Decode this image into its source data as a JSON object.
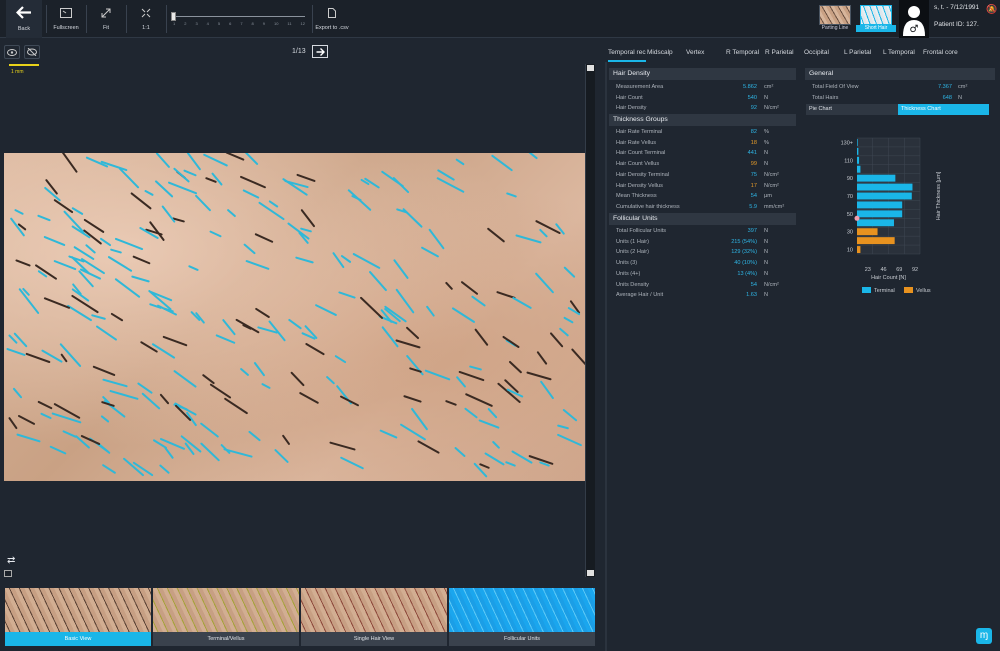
{
  "toolbar": {
    "back": "Back",
    "fullscreen": "Fullscreen",
    "fit": "Fit",
    "one_to_one": "1:1",
    "export": "Export to .csv",
    "slider_ticks": [
      "1",
      "2",
      "3",
      "4",
      "5",
      "6",
      "7",
      "8",
      "9",
      "10",
      "11",
      "12"
    ],
    "zoom_value": 0.0
  },
  "views": {
    "parting_line": "Parting Line",
    "short_hair": "Short Hair"
  },
  "patient": {
    "name_date": "s, t. - 7/12/1991",
    "id_label": "Patient ID:",
    "id_value": "127."
  },
  "image_nav": {
    "counter": "1/13",
    "scale": "1 mm"
  },
  "bottom_views": [
    {
      "label": "Basic View",
      "active": true
    },
    {
      "label": "Terminal/Vellus",
      "active": false
    },
    {
      "label": "Single Hair View",
      "active": false
    },
    {
      "label": "Follicular Units",
      "active": false
    }
  ],
  "tabs": [
    "Temporal rec",
    "Midscalp",
    "Vertex",
    "R Temporal",
    "R Parietal",
    "Occipital",
    "L Parietal",
    "L Temporal",
    "Frontal core"
  ],
  "hair_density": {
    "title": "Hair Density",
    "rows": [
      {
        "label": "Measurement Area",
        "value": "5.862",
        "unit": "cm²"
      },
      {
        "label": "Hair Count",
        "value": "540",
        "unit": "N"
      },
      {
        "label": "Hair Density",
        "value": "92",
        "unit": "N/cm²"
      }
    ]
  },
  "thickness_groups": {
    "title": "Thickness Groups",
    "rows": [
      {
        "label": "Hair Rate Terminal",
        "value": "82",
        "unit": "%",
        "orange": false
      },
      {
        "label": "Hair Rate Vellus",
        "value": "18",
        "unit": "%",
        "orange": true
      },
      {
        "label": "Hair Count Terminal",
        "value": "441",
        "unit": "N",
        "orange": false
      },
      {
        "label": "Hair Count Vellus",
        "value": "99",
        "unit": "N",
        "orange": true
      },
      {
        "label": "Hair Density Terminal",
        "value": "75",
        "unit": "N/cm²",
        "orange": false
      },
      {
        "label": "Hair Density Vellus",
        "value": "17",
        "unit": "N/cm²",
        "orange": true
      },
      {
        "label": "Mean Thickness",
        "value": "54",
        "unit": "µm",
        "orange": false
      },
      {
        "label": "Cumulative hair thickness",
        "value": "5.9",
        "unit": "mm/cm²",
        "orange": false
      }
    ]
  },
  "follicular_units": {
    "title": "Follicular Units",
    "rows": [
      {
        "label": "Total Follicular Units",
        "value": "397",
        "unit": "N"
      },
      {
        "label": "Units (1 Hair)",
        "value": "215 (54%)",
        "unit": "N"
      },
      {
        "label": "Units (2 Hair)",
        "value": "129 (32%)",
        "unit": "N"
      },
      {
        "label": "Units (3)",
        "value": "40 (10%)",
        "unit": "N"
      },
      {
        "label": "Units (4+)",
        "value": "13 (4%)",
        "unit": "N"
      },
      {
        "label": "Units Density",
        "value": "54",
        "unit": "N/cm²"
      },
      {
        "label": "Average Hair / Unit",
        "value": "1.63",
        "unit": "N"
      }
    ]
  },
  "general": {
    "title": "General",
    "rows": [
      {
        "label": "Total Field Of View",
        "value": "7.367",
        "unit": "cm²"
      },
      {
        "label": "Total Hairs",
        "value": "648",
        "unit": "N"
      }
    ],
    "pie_tab": "Pie Chart",
    "thickness_tab": "Thickness Chart"
  },
  "colors": {
    "accent": "#1ab6e8",
    "terminal": "#1ab6e8",
    "vellus": "#e8921f",
    "background": "#1f2630"
  },
  "chart_data": {
    "type": "bar",
    "orientation": "horizontal",
    "ylabel": "Hair Thickness [µm]",
    "xlabel": "Hair Count [N]",
    "ytick_labels": [
      "130+",
      "110",
      "90",
      "70",
      "50",
      "30",
      "10"
    ],
    "xtick_labels": [
      "23",
      "46",
      "69",
      "92"
    ],
    "xlim": [
      0,
      92
    ],
    "categories": [
      "130+",
      "120",
      "110",
      "100",
      "90",
      "80",
      "70",
      "60",
      "50",
      "40",
      "30",
      "20",
      "10"
    ],
    "series": [
      {
        "name": "Terminal",
        "color": "#1ab6e8",
        "values": [
          1,
          2,
          3,
          5,
          56,
          81,
          80,
          66,
          66,
          54,
          0,
          0,
          0
        ]
      },
      {
        "name": "Vellus",
        "color": "#e8921f",
        "values": [
          0,
          0,
          0,
          0,
          0,
          0,
          0,
          0,
          0,
          0,
          30,
          55,
          5
        ]
      }
    ],
    "legend": "bottom"
  }
}
